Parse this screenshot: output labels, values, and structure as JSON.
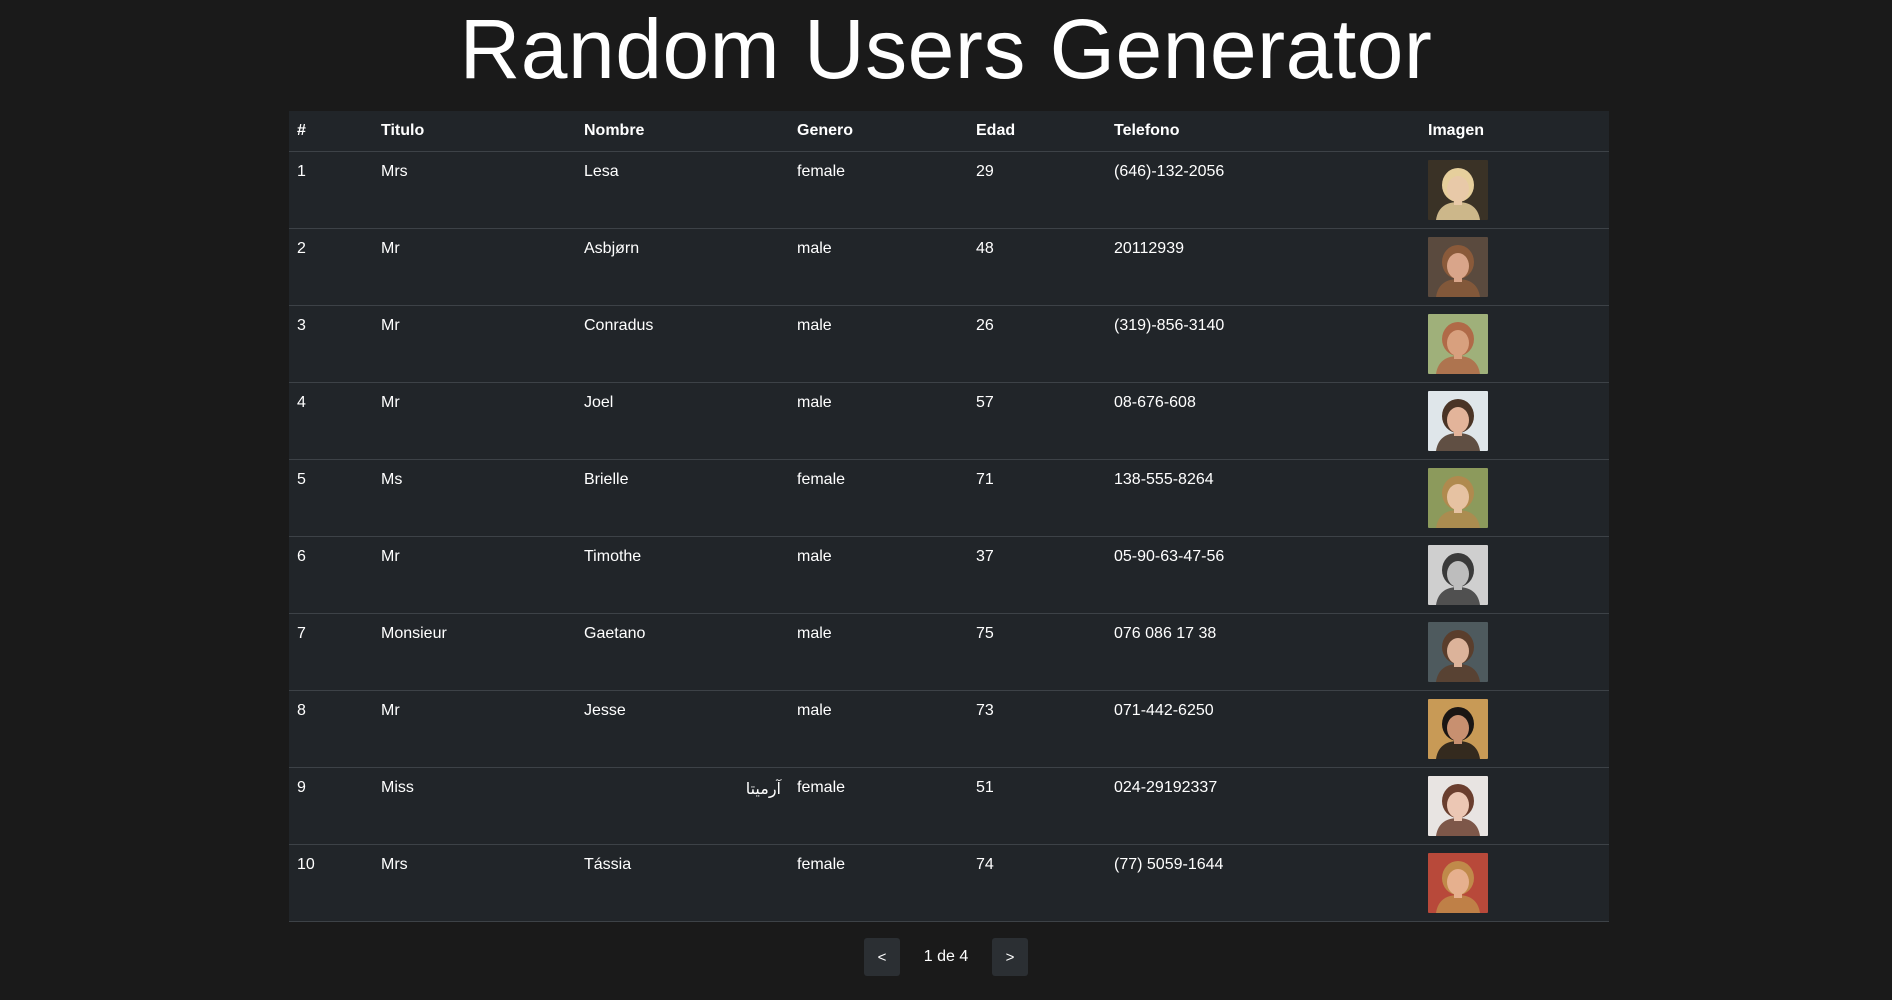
{
  "header": {
    "title": "Random Users Generator"
  },
  "table": {
    "columns": [
      "#",
      "Titulo",
      "Nombre",
      "Genero",
      "Edad",
      "Telefono",
      "Imagen"
    ],
    "rows": [
      {
        "num": "1",
        "titulo": "Mrs",
        "nombre": "Lesa",
        "genero": "female",
        "edad": "29",
        "telefono": "(646)-132-2056",
        "avatar": {
          "bg": "#3a3226",
          "skin": "#e8c9a8",
          "hair": "#e6cf9c"
        }
      },
      {
        "num": "2",
        "titulo": "Mr",
        "nombre": "Asbjørn",
        "genero": "male",
        "edad": "48",
        "telefono": "20112939",
        "avatar": {
          "bg": "#5a4a3e",
          "skin": "#d9a58a",
          "hair": "#8a5a3a"
        }
      },
      {
        "num": "3",
        "titulo": "Mr",
        "nombre": "Conradus",
        "genero": "male",
        "edad": "26",
        "telefono": "(319)-856-3140",
        "avatar": {
          "bg": "#9fb07a",
          "skin": "#d8a07e",
          "hair": "#b06a48"
        }
      },
      {
        "num": "4",
        "titulo": "Mr",
        "nombre": "Joel",
        "genero": "male",
        "edad": "57",
        "telefono": "08-676-608",
        "avatar": {
          "bg": "#dfe6ea",
          "skin": "#e3b49a",
          "hair": "#4a3426"
        }
      },
      {
        "num": "5",
        "titulo": "Ms",
        "nombre": "Brielle",
        "genero": "female",
        "edad": "71",
        "telefono": "138-555-8264",
        "avatar": {
          "bg": "#8c9a5c",
          "skin": "#e6c2a2",
          "hair": "#b08a4e"
        }
      },
      {
        "num": "6",
        "titulo": "Mr",
        "nombre": "Timothe",
        "genero": "male",
        "edad": "37",
        "telefono": "05-90-63-47-56",
        "avatar": {
          "bg": "#cfcfcf",
          "skin": "#bdbdbd",
          "hair": "#3a3a3a"
        }
      },
      {
        "num": "7",
        "titulo": "Monsieur",
        "nombre": "Gaetano",
        "genero": "male",
        "edad": "75",
        "telefono": "076 086 17 38",
        "avatar": {
          "bg": "#4e5a5e",
          "skin": "#dcb39a",
          "hair": "#5a3e2c"
        }
      },
      {
        "num": "8",
        "titulo": "Mr",
        "nombre": "Jesse",
        "genero": "male",
        "edad": "73",
        "telefono": "071-442-6250",
        "avatar": {
          "bg": "#c89a56",
          "skin": "#c89070",
          "hair": "#1a1614"
        }
      },
      {
        "num": "9",
        "titulo": "Miss",
        "nombre": "آرمیتا",
        "genero": "female",
        "edad": "51",
        "telefono": "024-29192337",
        "avatar": {
          "bg": "#e8e4e2",
          "skin": "#ecc7b4",
          "hair": "#6a3e2e"
        }
      },
      {
        "num": "10",
        "titulo": "Mrs",
        "nombre": "Tássia",
        "genero": "female",
        "edad": "74",
        "telefono": "(77) 5059-1644",
        "avatar": {
          "bg": "#b8493a",
          "skin": "#e6b08e",
          "hair": "#c08a4a"
        }
      }
    ]
  },
  "pagination": {
    "prev_label": "<",
    "page_text": "1 de 4",
    "next_label": ">"
  }
}
